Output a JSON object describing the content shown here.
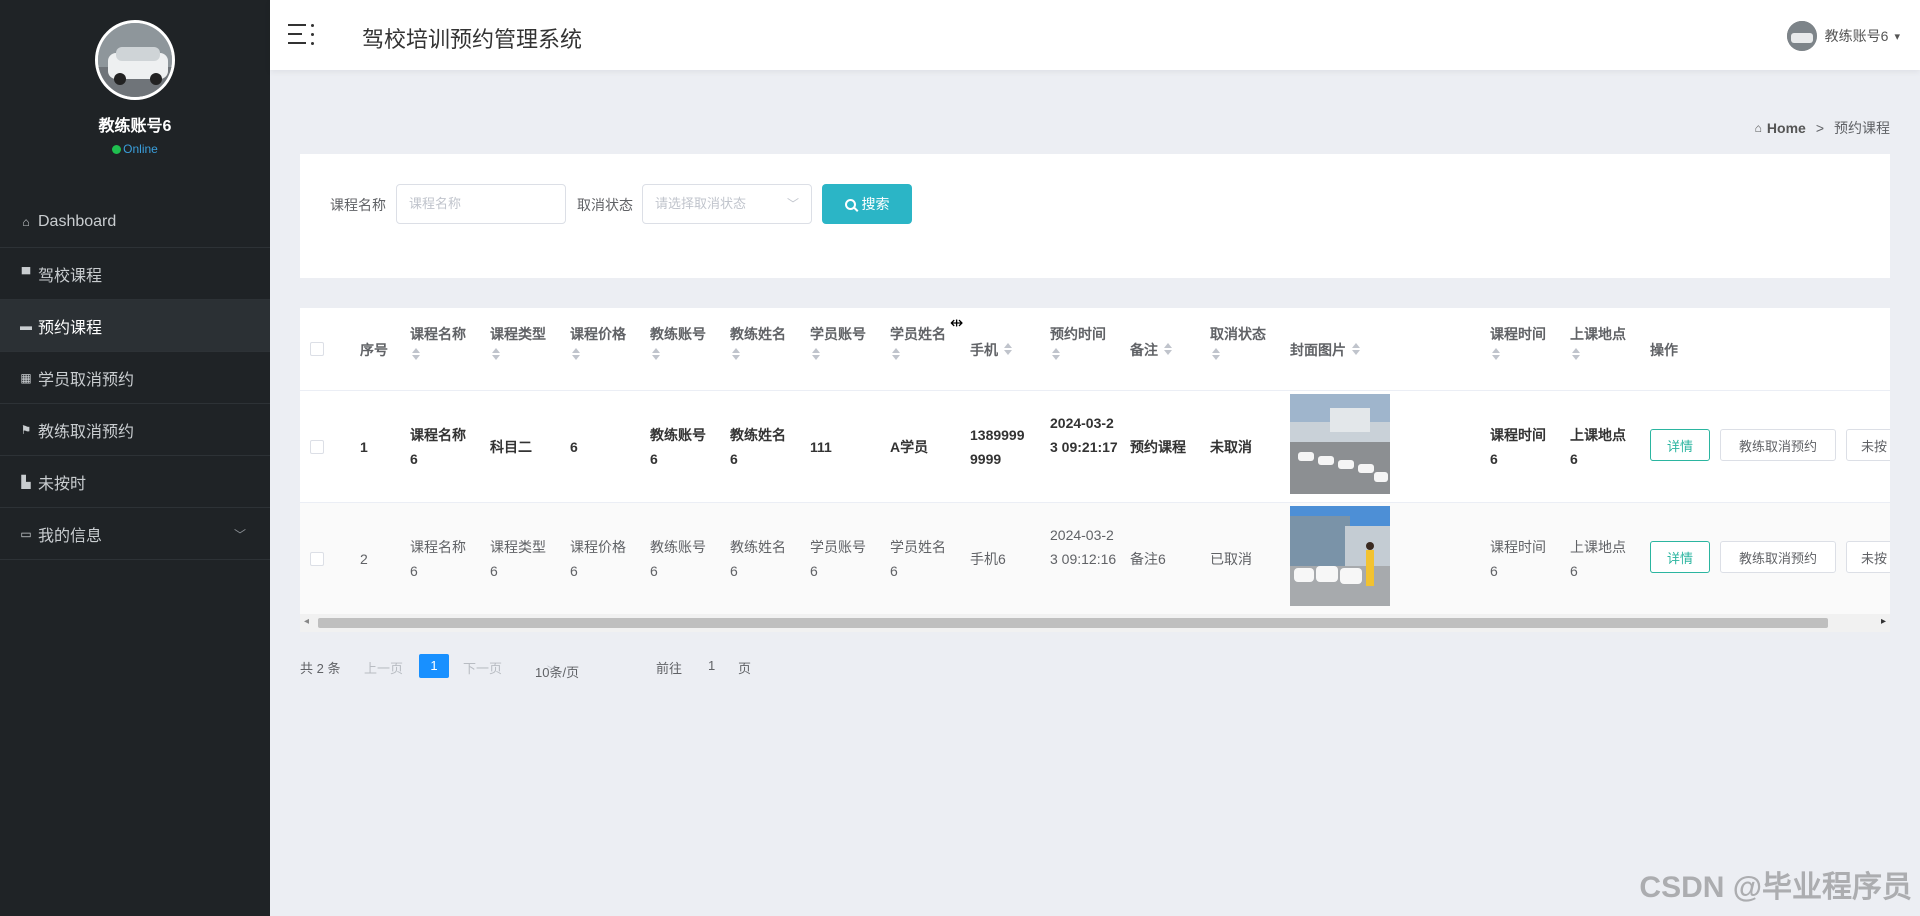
{
  "sidebar": {
    "user_name": "教练账号6",
    "status": "Online",
    "items": [
      {
        "icon": "house-icon",
        "label": "Dashboard"
      },
      {
        "icon": "comment-icon",
        "label": "驾校课程"
      },
      {
        "icon": "ticket-icon",
        "label": "预约课程"
      },
      {
        "icon": "grid-icon",
        "label": "学员取消预约"
      },
      {
        "icon": "flag-icon",
        "label": "教练取消预约"
      },
      {
        "icon": "bar-chart-icon",
        "label": "未按时"
      },
      {
        "icon": "card-icon",
        "label": "我的信息"
      }
    ]
  },
  "header": {
    "title": "驾校培训预约管理系统",
    "user": "教练账号6"
  },
  "breadcrumb": {
    "home": "Home",
    "separator": ">",
    "current": "预约课程"
  },
  "search": {
    "course_label": "课程名称",
    "course_placeholder": "课程名称",
    "cancel_label": "取消状态",
    "cancel_placeholder": "请选择取消状态",
    "button": "搜索"
  },
  "table": {
    "headers": {
      "index": "序号",
      "course_name": "课程名称",
      "course_type": "课程类型",
      "course_price": "课程价格",
      "coach_account": "教练账号",
      "coach_name": "教练姓名",
      "student_account": "学员账号",
      "student_name": "学员姓名",
      "phone": "手机",
      "booking_time": "预约时间",
      "remark": "备注",
      "cancel_status": "取消状态",
      "cover": "封面图片",
      "course_time": "课程时间",
      "location": "上课地点",
      "actions": "操作"
    },
    "rows": [
      {
        "index": "1",
        "course_name": "课程名称6",
        "course_type": "科目二",
        "course_price": "6",
        "coach_account": "教练账号6",
        "coach_name": "教练姓名6",
        "student_account": "111",
        "student_name": "A学员",
        "phone": "13899999999",
        "booking_time": "2024-03-23 09:21:17",
        "remark": "预约课程",
        "cancel_status": "未取消",
        "course_time": "课程时间6",
        "location": "上课地点6",
        "btn_detail": "详情",
        "btn_cancel": "教练取消预约",
        "btn_late": "未按"
      },
      {
        "index": "2",
        "course_name": "课程名称6",
        "course_type": "课程类型6",
        "course_price": "课程价格6",
        "coach_account": "教练账号6",
        "coach_name": "教练姓名6",
        "student_account": "学员账号6",
        "student_name": "学员姓名6",
        "phone": "手机6",
        "booking_time": "2024-03-23 09:12:16",
        "remark": "备注6",
        "cancel_status": "已取消",
        "course_time": "课程时间6",
        "location": "上课地点6",
        "btn_detail": "详情",
        "btn_cancel": "教练取消预约",
        "btn_late": "未按"
      }
    ]
  },
  "pagination": {
    "total": "共 2 条",
    "prev": "上一页",
    "current_page": "1",
    "next": "下一页",
    "page_size": "10条/页",
    "goto_label": "前往",
    "goto_value": "1",
    "page_suffix": "页"
  },
  "watermark": "CSDN @毕业程序员",
  "colors": {
    "sidebar_bg": "#1f2326",
    "accent": "#2bb5c6",
    "pager_active": "#1890ff",
    "online_dot": "#1fbf4f"
  }
}
